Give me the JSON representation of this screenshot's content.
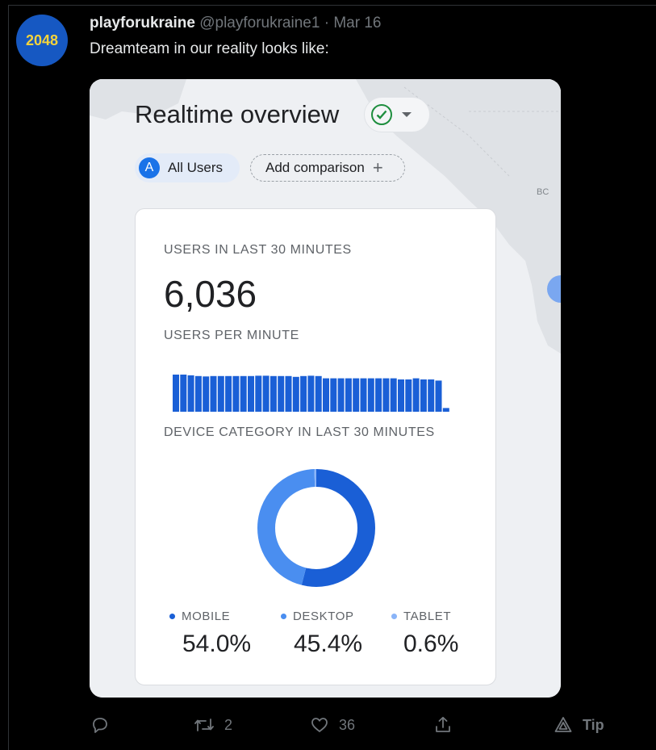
{
  "tweet": {
    "avatar_text": "2048",
    "display_name": "playforukraine",
    "handle": "@playforukraine1",
    "separator": "·",
    "date": "Mar 16",
    "text": "Dreamteam in our reality looks like:"
  },
  "media": {
    "title": "Realtime overview",
    "user_chip": {
      "letter": "A",
      "label": "All Users"
    },
    "compare_chip": {
      "label": "Add comparison",
      "icon": "plus-icon"
    },
    "map_label": "BC",
    "card": {
      "users_label": "USERS IN LAST 30 MINUTES",
      "users_value": "6,036",
      "per_minute_label": "USERS PER MINUTE",
      "device_label": "DEVICE CATEGORY IN LAST 30 MINUTES",
      "devices": [
        {
          "name": "MOBILE",
          "value": "54.0%",
          "color": "#1a5fd6"
        },
        {
          "name": "DESKTOP",
          "value": "45.4%",
          "color": "#4a8ef0"
        },
        {
          "name": "TABLET",
          "value": "0.6%",
          "color": "#8ab4f8"
        }
      ]
    }
  },
  "chart_data": [
    {
      "type": "bar",
      "title": "USERS PER MINUTE",
      "values": [
        1.0,
        1.0,
        0.98,
        0.96,
        0.95,
        0.96,
        0.96,
        0.96,
        0.96,
        0.96,
        0.96,
        0.97,
        0.97,
        0.96,
        0.96,
        0.96,
        0.94,
        0.96,
        0.97,
        0.96,
        0.9,
        0.9,
        0.9,
        0.9,
        0.9,
        0.9,
        0.9,
        0.9,
        0.9,
        0.9,
        0.87,
        0.87,
        0.9,
        0.87,
        0.87,
        0.84,
        0.1
      ],
      "color": "#1a5fd6"
    },
    {
      "type": "pie",
      "title": "DEVICE CATEGORY IN LAST 30 MINUTES",
      "categories": [
        "MOBILE",
        "DESKTOP",
        "TABLET"
      ],
      "values": [
        54.0,
        45.4,
        0.6
      ],
      "colors": [
        "#1a5fd6",
        "#4a8ef0",
        "#8ab4f8"
      ]
    }
  ],
  "actions": {
    "reply": {
      "icon": "reply-icon",
      "count": ""
    },
    "retweet": {
      "icon": "retweet-icon",
      "count": "2"
    },
    "like": {
      "icon": "heart-icon",
      "count": "36"
    },
    "share": {
      "icon": "share-icon",
      "count": ""
    },
    "tip": {
      "icon": "tip-icon",
      "label": "Tip"
    }
  }
}
